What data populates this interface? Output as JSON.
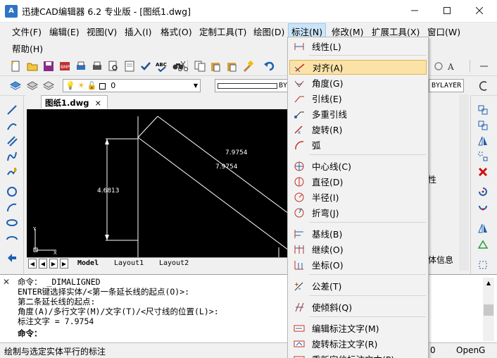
{
  "window": {
    "logo": "A",
    "title": "迅捷CAD编辑器 6.2 专业版  - [图纸1.dwg]",
    "minimize_icon": "minimize-icon",
    "maximize_icon": "maximize-icon",
    "close_icon": "close-icon"
  },
  "menubar": {
    "items": [
      "文件(F)",
      "编辑(E)",
      "视图(V)",
      "插入(I)",
      "格式(O)",
      "定制工具(T)",
      "绘图(D)",
      "标注(N)",
      "修改(M)",
      "扩展工具(X)",
      "窗口(W)",
      "帮助(H)"
    ],
    "active": "标注(N)"
  },
  "toolbar2": {
    "layer_value": "0",
    "linetype_value": "BY",
    "lineweight_value": "BYLAYER"
  },
  "document": {
    "tab_label": "图纸1.dwg",
    "tab_close": "×"
  },
  "drawing": {
    "dim_vertical": "4.6813",
    "dim_aligned_1": "7.9754",
    "dim_aligned_2": "7.9754",
    "axis_y": "Y",
    "axis_x": "X"
  },
  "layouts": {
    "tabs": [
      "Model",
      "Layout1",
      "Layout2"
    ],
    "active": "Model"
  },
  "props_fragment": {
    "line1": "性",
    "line2": "体信息"
  },
  "dimension_menu": {
    "items": [
      {
        "label": "线性(L)",
        "icon": "linear-dim-icon"
      },
      {
        "label": "对齐(A)",
        "icon": "aligned-dim-icon"
      },
      {
        "label": "角度(G)",
        "icon": "angular-dim-icon"
      },
      {
        "label": "引线(E)",
        "icon": "leader-icon"
      },
      {
        "label": "多重引线",
        "icon": "multileader-icon"
      },
      {
        "label": "旋转(R)",
        "icon": "rotated-dim-icon"
      },
      {
        "label": "弧",
        "icon": "arc-dim-icon"
      },
      {
        "label": "中心线(C)",
        "icon": "centermark-icon"
      },
      {
        "label": "直径(D)",
        "icon": "diameter-dim-icon"
      },
      {
        "label": "半径(I)",
        "icon": "radius-dim-icon"
      },
      {
        "label": "折弯(J)",
        "icon": "jogged-dim-icon"
      },
      {
        "label": "基线(B)",
        "icon": "baseline-dim-icon"
      },
      {
        "label": "继续(O)",
        "icon": "continue-dim-icon"
      },
      {
        "label": "坐标(O)",
        "icon": "ordinate-dim-icon"
      },
      {
        "label": "公差(T)",
        "icon": "tolerance-icon"
      },
      {
        "label": "使倾斜(Q)",
        "icon": "oblique-icon"
      },
      {
        "label": "编辑标注文字(M)",
        "icon": "edit-dim-text-icon"
      },
      {
        "label": "旋转标注文字(R)",
        "icon": "rotate-dim-text-icon"
      },
      {
        "label": "重新定位标注文本(P)",
        "icon": "reposition-dim-text-icon"
      }
    ],
    "highlighted": "对齐(A)"
  },
  "command": {
    "lines": [
      "命令：  _DIMALIGNED",
      "ENTER键选择实体/<第一条延长线的起点(O)>:",
      "第二条延长线的起点:",
      "角度(A)/多行文字(M)/文字(T)/<尺寸线的位置(L)>:",
      "标注文字 = 7.9754"
    ],
    "prompt": "命令："
  },
  "status": {
    "text": "绘制与选定实体平行的标注",
    "right1": "0",
    "right2": "OpenG"
  }
}
